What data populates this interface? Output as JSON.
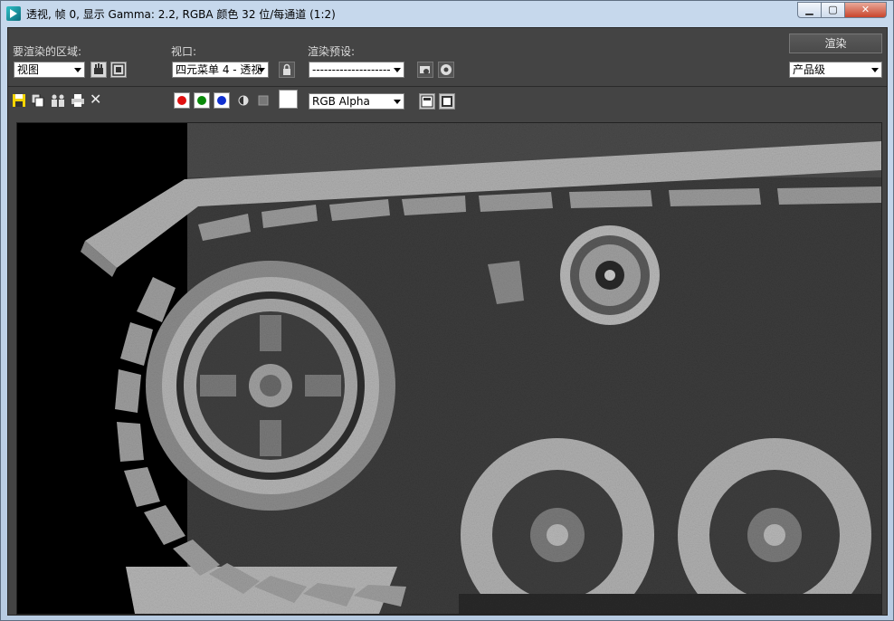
{
  "window": {
    "title": "透视, 帧 0, 显示 Gamma: 2.2, RGBA 颜色 32 位/每通道 (1:2)",
    "min_label": "▁",
    "max_label": "▢",
    "close_label": "✕"
  },
  "controls": {
    "area_label": "要渲染的区域:",
    "area_value": "视图",
    "viewport_label": "视口:",
    "viewport_value": "四元菜单 4 - 透视",
    "preset_label": "渲染预设:",
    "preset_value": "--------------------",
    "render_button": "渲染",
    "quality_value": "产品级"
  },
  "toolbar": {
    "channel_value": "RGB Alpha",
    "channels": [
      {
        "name": "red",
        "color": "#e01010"
      },
      {
        "name": "green",
        "color": "#0a8a0a"
      },
      {
        "name": "blue",
        "color": "#1030d0"
      }
    ],
    "clear_label": "✕"
  },
  "icons": {
    "save": "save-icon",
    "copy": "copy-icon",
    "clone": "clone-icon",
    "print": "print-icon",
    "clear": "close-icon",
    "lock": "lock-icon"
  }
}
